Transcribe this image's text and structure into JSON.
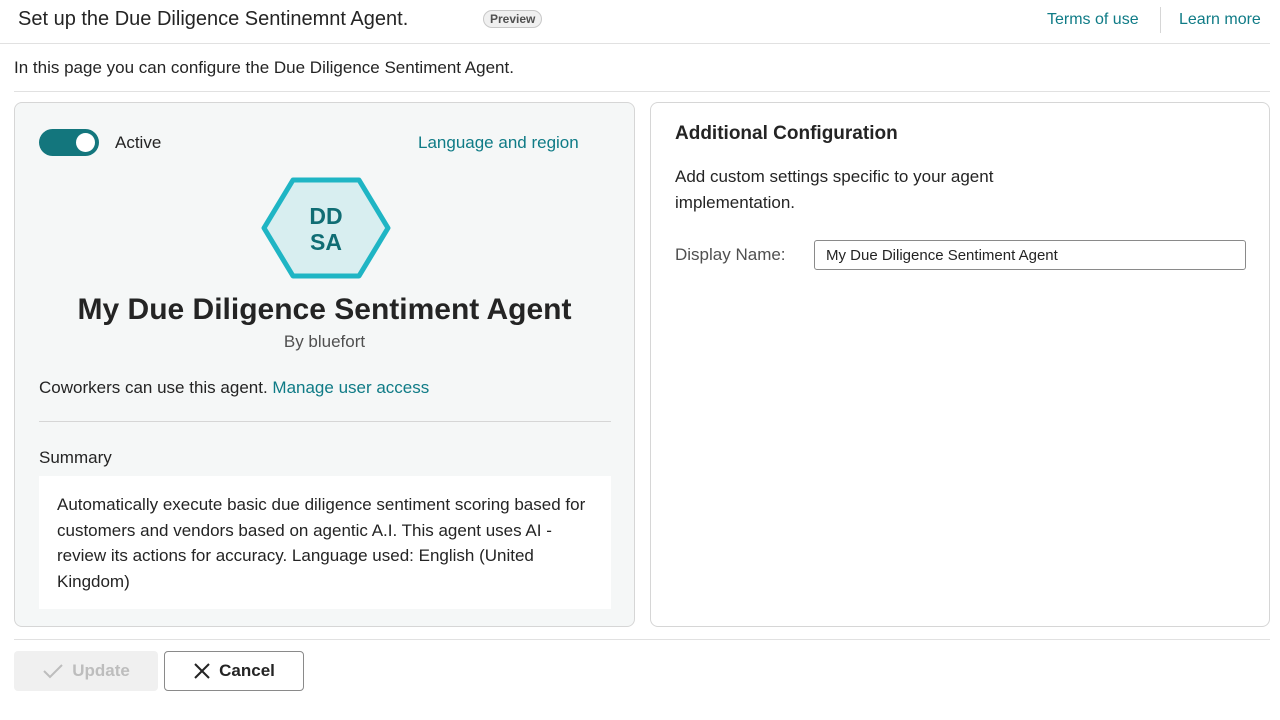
{
  "header": {
    "title": "Set up the Due Diligence Sentinemnt Agent.",
    "badge": "Preview",
    "terms_link": "Terms of use",
    "learn_link": "Learn more"
  },
  "intro": "In this page you can configure the Due Diligence Sentiment Agent.",
  "agent_card": {
    "toggle_on": true,
    "toggle_label": "Active",
    "language_link": "Language and region",
    "initials_line1": "DD",
    "initials_line2": "SA",
    "name": "My Due Diligence Sentiment Agent",
    "by": "By bluefort",
    "coworkers_text": "Coworkers can use this agent.",
    "manage_link": "Manage user access",
    "summary_label": "Summary",
    "summary_text": "Automatically execute basic due diligence sentiment scoring based for customers and vendors based on agentic A.I. This agent uses AI - review its actions for accuracy. Language used: English (United Kingdom)"
  },
  "config_card": {
    "title": "Additional Configuration",
    "description": "Add custom settings specific to your agent implementation.",
    "display_name_label": "Display Name:",
    "display_name_value": "My Due Diligence Sentiment Agent"
  },
  "footer": {
    "update_label": "Update",
    "cancel_label": "Cancel"
  },
  "colors": {
    "accent": "#0f7b86",
    "toggle": "#13767d",
    "hex_border": "#1fb5c4",
    "hex_fill": "#d8eef0"
  },
  "icons": {
    "update": "check-icon",
    "cancel": "close-icon"
  }
}
